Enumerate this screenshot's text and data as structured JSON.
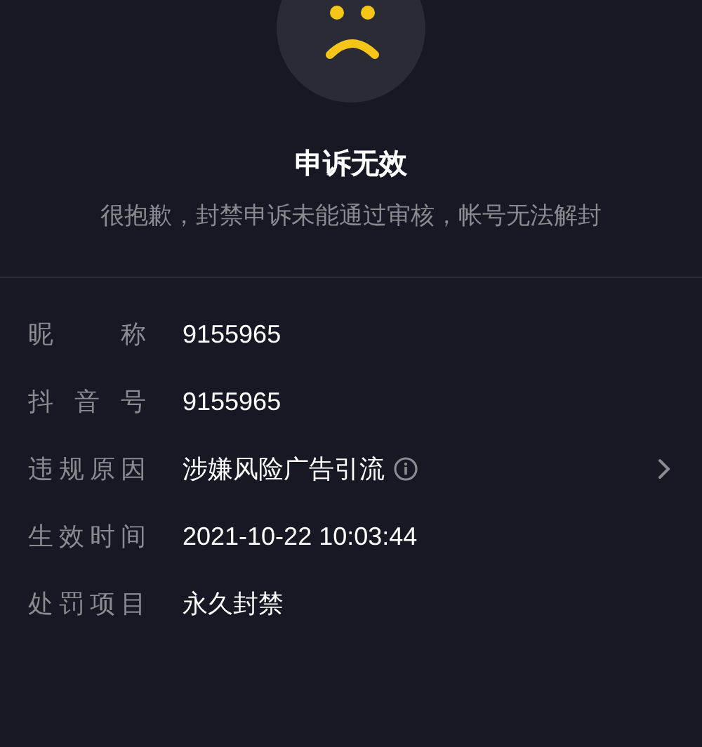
{
  "result": {
    "title": "申诉无效",
    "message": "很抱歉，封禁申诉未能通过审核，帐号无法解封"
  },
  "details": [
    {
      "label": "昵称",
      "value": "9155965",
      "kind": "plain"
    },
    {
      "label": "抖音号",
      "value": "9155965",
      "kind": "plain"
    },
    {
      "label": "违规原因",
      "value": "涉嫌风险广告引流",
      "kind": "detail"
    },
    {
      "label": "生效时间",
      "value": "2021-10-22 10:03:44",
      "kind": "plain"
    },
    {
      "label": "处罚项目",
      "value": "永久封禁",
      "kind": "plain"
    }
  ]
}
